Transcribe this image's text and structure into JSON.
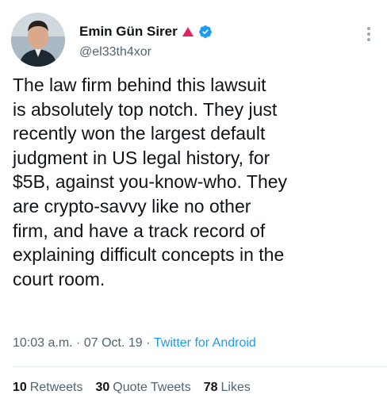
{
  "tweet": {
    "author_name": "Emin Gün Sirer",
    "handle": "@el33th4xor",
    "text": "The law firm behind this lawsuit\nis absolutely top notch. They just\nrecently won the largest default\njudgment in US legal history, for\n$5B, against you-know-who. They\nare crypto-savvy like no other\nfirm, and have a track record of\nexplaining difficult concepts in the\ncourt room.",
    "time": "10:03 a.m.",
    "separator": " · ",
    "date": "07 Oct. 19",
    "source": "Twitter for Android"
  },
  "stats": [
    {
      "count": "10",
      "label": "Retweets"
    },
    {
      "count": "30",
      "label": "Quote Tweets"
    },
    {
      "count": "78",
      "label": "Likes"
    }
  ],
  "icons": {
    "name_badge": "red-triangle-icon",
    "verified": "verified-badge-icon",
    "menu": "more-options-icon"
  },
  "colors": {
    "accent": "#1d9bf0",
    "triangle": "#e0245e",
    "text": "#0f1419",
    "muted": "#536471"
  }
}
